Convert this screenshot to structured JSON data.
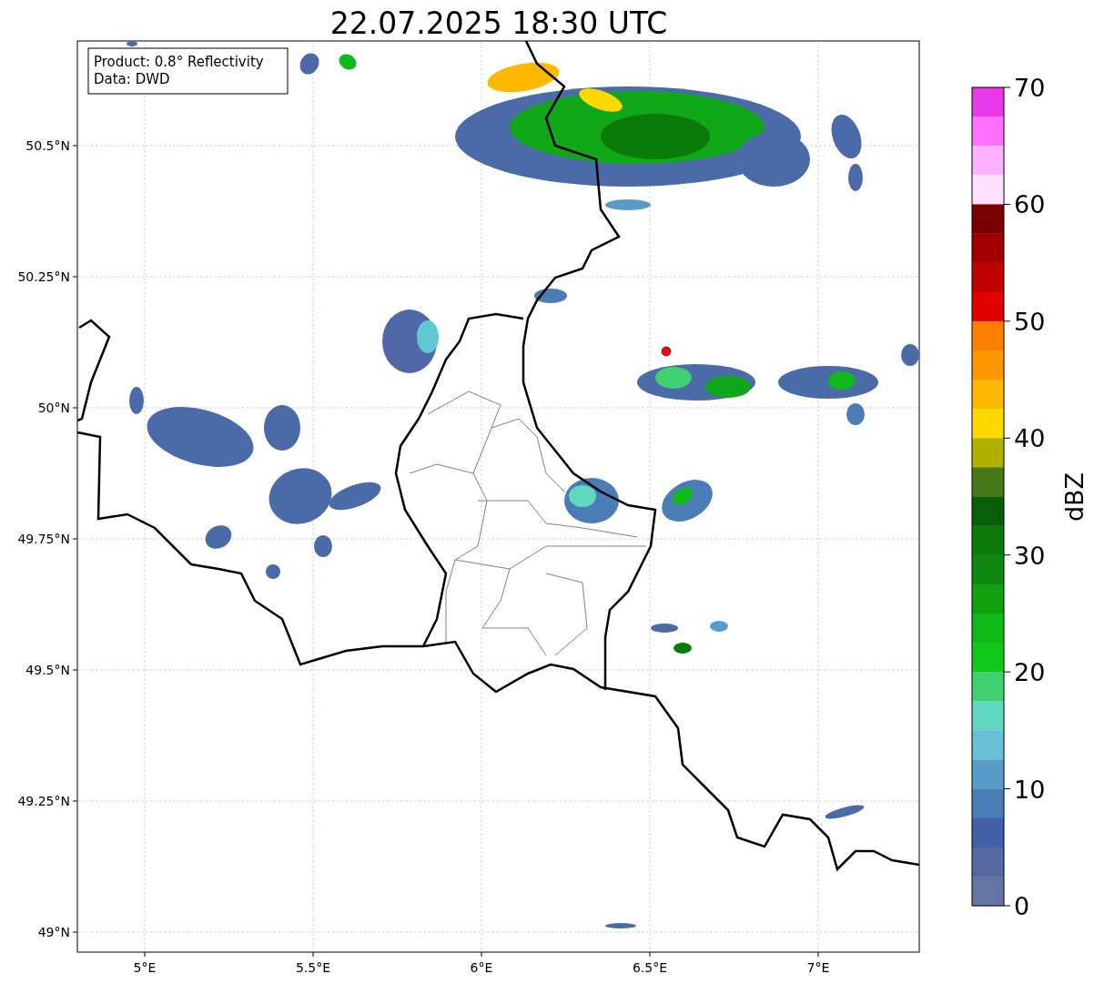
{
  "title": "22.07.2025 18:30 UTC",
  "info_box": {
    "lines": [
      "Product: 0.8° Reflectivity",
      "Data: DWD"
    ]
  },
  "map": {
    "xticks": [
      "5°E",
      "5.5°E",
      "6°E",
      "6.5°E",
      "7°E"
    ],
    "yticks": [
      "50.5°N",
      "50.25°N",
      "50°N",
      "49.75°N",
      "49.5°N",
      "49.25°N",
      "49°N"
    ]
  },
  "colorbar": {
    "label": "dBZ",
    "ticks": [
      "70",
      "60",
      "50",
      "40",
      "30",
      "20",
      "10",
      "0"
    ],
    "segments": [
      {
        "color": "#e838e8"
      },
      {
        "color": "#ff70ff"
      },
      {
        "color": "#ffb0ff"
      },
      {
        "color": "#ffe0ff"
      },
      {
        "color": "#7a0000"
      },
      {
        "color": "#a00000"
      },
      {
        "color": "#c00000"
      },
      {
        "color": "#e00000"
      },
      {
        "color": "#ff8000"
      },
      {
        "color": "#ff9800"
      },
      {
        "color": "#ffb800"
      },
      {
        "color": "#ffd800"
      },
      {
        "color": "#b0b000"
      },
      {
        "color": "#467818"
      },
      {
        "color": "#0a5e0a"
      },
      {
        "color": "#0a7a0a"
      },
      {
        "color": "#108810"
      },
      {
        "color": "#10a010"
      },
      {
        "color": "#10b818"
      },
      {
        "color": "#10c818"
      },
      {
        "color": "#40d070"
      },
      {
        "color": "#60d8c0"
      },
      {
        "color": "#68c0d8"
      },
      {
        "color": "#5a9cc8"
      },
      {
        "color": "#4a7db5"
      },
      {
        "color": "#4060a8"
      },
      {
        "color": "#5568a0"
      },
      {
        "color": "#6475a5"
      }
    ]
  }
}
